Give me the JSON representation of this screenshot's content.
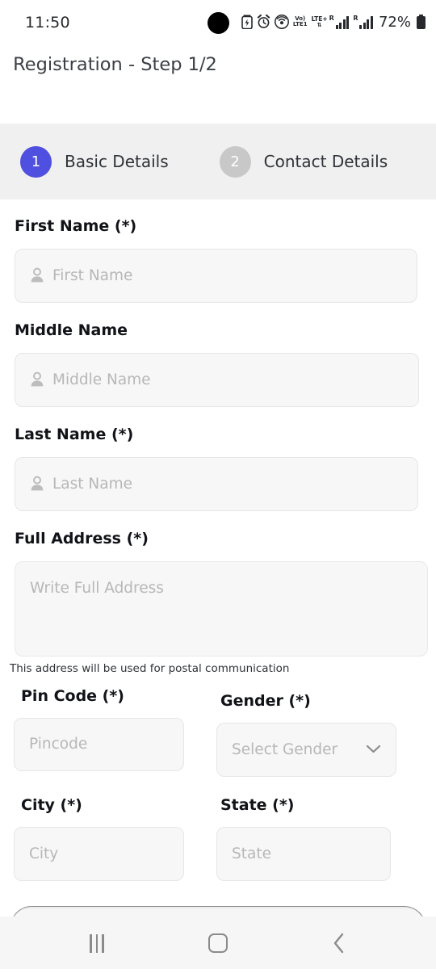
{
  "status_bar": {
    "time": "11:50",
    "battery_percent": "72%",
    "volte_label_top": "Vo)",
    "volte_label_bottom": "LTE1",
    "network_label_top": "LTE+",
    "network_label_bottom": "",
    "roaming_mark_1": "R",
    "roaming_mark_2": "R",
    "icons": [
      "camera-punch-hole",
      "battery-saver-icon",
      "alarm-icon",
      "hotspot-icon",
      "volte-icon",
      "signal-bars-sim1-icon",
      "signal-bars-sim2-icon",
      "battery-icon"
    ]
  },
  "header": {
    "title": "Registration - Step 1/2"
  },
  "stepper": {
    "active_color": "#4f4fe0",
    "inactive_color": "#c8c8c8",
    "band_color": "#f0f0f0",
    "steps": [
      {
        "number": "1",
        "label": "Basic Details",
        "state": "active"
      },
      {
        "number": "2",
        "label": "Contact Details",
        "state": "inactive"
      }
    ]
  },
  "form": {
    "first_name": {
      "label": "First Name (*)",
      "placeholder": "First Name",
      "value": "",
      "icon": "person-icon"
    },
    "middle_name": {
      "label": "Middle Name",
      "placeholder": "Middle Name",
      "value": "",
      "icon": "person-icon"
    },
    "last_name": {
      "label": "Last Name (*)",
      "placeholder": "Last Name",
      "value": "",
      "icon": "person-icon"
    },
    "full_address": {
      "label": "Full Address (*)",
      "placeholder": "Write Full Address",
      "value": "",
      "helper": "This address will be used for postal communication"
    },
    "pin_code": {
      "label": "Pin Code (*)",
      "placeholder": "Pincode",
      "value": ""
    },
    "gender": {
      "label": "Gender (*)",
      "placeholder": "Select Gender",
      "value": "",
      "icon": "chevron-down-icon"
    },
    "city": {
      "label": "City (*)",
      "placeholder": "City",
      "value": ""
    },
    "state": {
      "label": "State (*)",
      "placeholder": "State",
      "value": ""
    }
  },
  "nav_bar": {
    "recents": "recents-icon",
    "home": "home-icon",
    "back": "back-icon"
  }
}
